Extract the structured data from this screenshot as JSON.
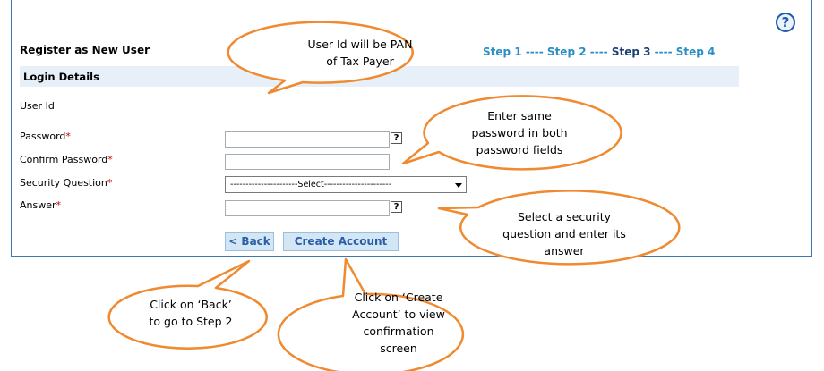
{
  "form": {
    "title": "Register as New User",
    "steps": {
      "step1": "Step 1",
      "sep1": " ---- ",
      "step2": "Step 2",
      "sep2": " ---- ",
      "step3": "Step 3",
      "sep3": " ---- ",
      "step4": "Step 4"
    },
    "section_title": "Login Details",
    "help_glyph": "?",
    "field_help_glyph": "?",
    "required_mark": "*",
    "fields": {
      "user_id_label": "User Id",
      "password_label": "Password",
      "confirm_password_label": "Confirm Password",
      "security_question_label": "Security Question",
      "security_question_value": "----------------------Select----------------------",
      "answer_label": "Answer"
    },
    "buttons": {
      "back": "< Back",
      "create_account": "Create Account"
    }
  },
  "callouts": {
    "pan": "User Id will be PAN\nof Tax Payer",
    "password": "Enter same\npassword in both\npassword fields",
    "security": "Select a security\nquestion and enter its\nanswer",
    "back": "Click on ‘Back’\nto go to Step 2",
    "create": "Click on ‘Create\nAccount’ to view\nconfirmation\nscreen"
  },
  "colors": {
    "callout_fill": "#ffffff",
    "callout_border": "#f08a30",
    "step_link": "#2a8fc6",
    "step_current": "#1a3f74",
    "section_bar": "#e7eff8",
    "button_bg": "#d3e6f6",
    "button_text": "#2a5ea5",
    "panel_border": "#3f76b0",
    "required": "#d00000"
  },
  "icons": {
    "help": "question-circle-icon",
    "field_help": "question-box-icon",
    "select_arrow": "caret-down-icon"
  }
}
